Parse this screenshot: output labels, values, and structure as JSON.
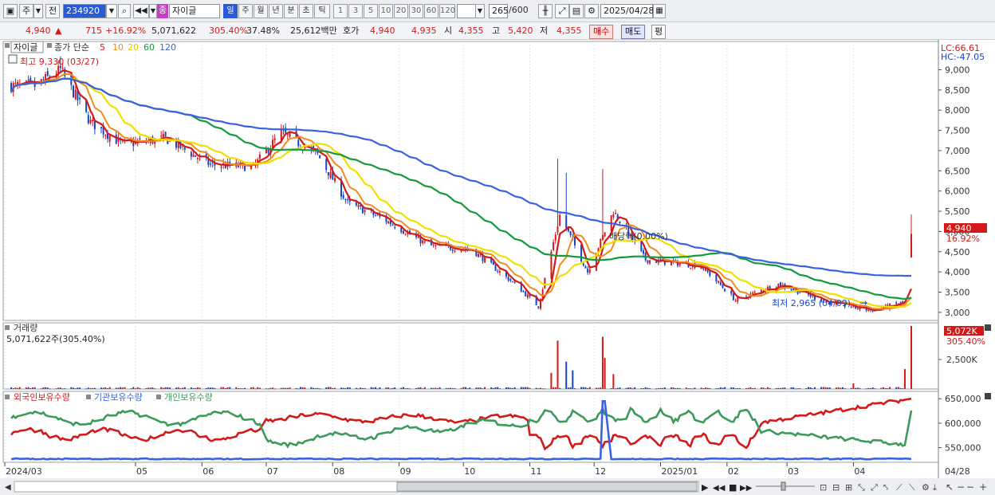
{
  "toolbar": {
    "market": "주",
    "prev_btn": "전",
    "code": "234920",
    "type_badge": "종",
    "name": "자이글",
    "periods": [
      "일",
      "주",
      "월",
      "년",
      "분",
      "초",
      "틱"
    ],
    "active_period": "일",
    "intervals": [
      "1",
      "3",
      "5",
      "10",
      "20",
      "30",
      "60",
      "120"
    ],
    "count": "265",
    "count_total": "/600",
    "date": "2025/04/28"
  },
  "quote": {
    "price": "4,940",
    "change": "715",
    "change_pct": "+16.92%",
    "volume": "5,071,622",
    "volume_pct": "305.40%",
    "turnover": "37.48%",
    "amount": "25,612백만",
    "bid_label": "호가",
    "bid1": "4,940",
    "bid2": "4,935",
    "open_label": "시",
    "open": "4,355",
    "high_label": "고",
    "high": "5,420",
    "low_label": "저",
    "low": "4,355",
    "buy_btn": "매수",
    "sell_btn": "매도",
    "avg_btn": "평"
  },
  "colors": {
    "up": "#d21a1a",
    "down": "#1546c8",
    "ma5": "#d21a1a",
    "ma10": "#f08c1e",
    "ma20": "#f0e000",
    "ma60": "#139a3a",
    "ma120": "#3a62e0",
    "foreign": "#d21a1a",
    "institution": "#3a62e0",
    "individual": "#3c9a5a"
  },
  "price_panel": {
    "legend_name": "자이글",
    "legend_ma_label": "종가 단순",
    "ma_periods": [
      "5",
      "10",
      "20",
      "60",
      "120"
    ],
    "high_note": "최고 9,330 (03/27)",
    "low_note": "최저 2,965 (04/09)",
    "ex_rights_note": "배당락(0.00%)",
    "lc": "LC:66.61",
    "hc": "HC:-47.05",
    "last_price_tag": "4,940",
    "last_pct_tag": "16.92%",
    "y_ticks": [
      "9,000",
      "8,500",
      "8,000",
      "7,500",
      "7,000",
      "6,500",
      "6,000",
      "5,500",
      "5,000",
      "4,500",
      "4,000",
      "3,500",
      "3,000"
    ]
  },
  "volume_panel": {
    "title": "거래량",
    "value": "5,071,622주(305.40%)",
    "last_tag": "5,072K",
    "last_pct": "305.40%",
    "y_ticks": [
      "2,500K"
    ]
  },
  "holding_panel": {
    "legend": [
      "외국인보유수량",
      "기관보유수량",
      "개인보유수량"
    ],
    "y_ticks": [
      "650,000",
      "600,000",
      "550,000"
    ]
  },
  "x_axis": {
    "labels": [
      "2024/03",
      "05",
      "06",
      "07",
      "08",
      "09",
      "10",
      "11",
      "12",
      "2025/01",
      "02",
      "03",
      "04"
    ],
    "right_label": "04/28"
  },
  "chart_data": {
    "type": "candlestick",
    "y_range": [
      2800,
      9700
    ],
    "x_labels": [
      "2024/03",
      "05",
      "06",
      "07",
      "08",
      "09",
      "10",
      "11",
      "12",
      "2025/01",
      "02",
      "03",
      "04"
    ],
    "close_keypoints": [
      [
        "2024/03/15",
        8600
      ],
      [
        "2024/03/27",
        9000
      ],
      [
        "2024/04/10",
        7700
      ],
      [
        "2024/04/25",
        7150
      ],
      [
        "2024/05/15",
        7300
      ],
      [
        "2024/06/05",
        6650
      ],
      [
        "2024/06/25",
        6600
      ],
      [
        "2024/07/08",
        7450
      ],
      [
        "2024/07/25",
        6900
      ],
      [
        "2024/08/08",
        5700
      ],
      [
        "2024/08/25",
        5300
      ],
      [
        "2024/09/15",
        4650
      ],
      [
        "2024/10/05",
        4550
      ],
      [
        "2024/10/25",
        3700
      ],
      [
        "2024/11/05",
        3150
      ],
      [
        "2024/11/15",
        5400
      ],
      [
        "2024/11/28",
        4000
      ],
      [
        "2024/12/10",
        5500
      ],
      [
        "2024/12/25",
        4300
      ],
      [
        "2025/01/20",
        4150
      ],
      [
        "2025/02/05",
        3300
      ],
      [
        "2025/02/25",
        3700
      ],
      [
        "2025/03/20",
        3250
      ],
      [
        "2025/04/09",
        3050
      ],
      [
        "2025/04/25",
        3250
      ],
      [
        "2025/04/28",
        4940
      ]
    ],
    "last": {
      "date": "2025/04/28",
      "open": 4355,
      "high": 5420,
      "low": 4355,
      "close": 4940,
      "volume": 5071622
    },
    "period_high": {
      "value": 9330,
      "date": "03/27"
    },
    "period_low": {
      "value": 2965,
      "date": "04/09"
    },
    "holding_range": [
      520000,
      665000
    ]
  }
}
